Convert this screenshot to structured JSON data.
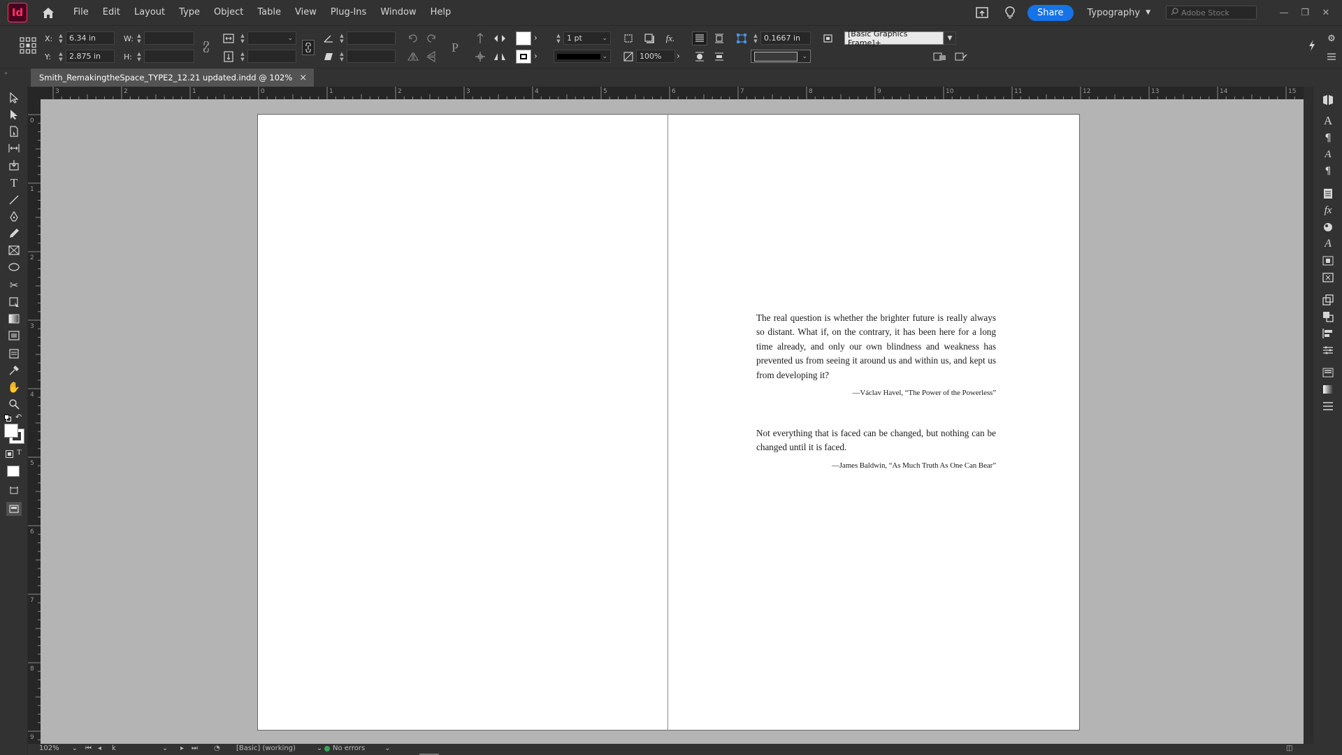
{
  "app": {
    "logo": "Id",
    "menu": [
      "File",
      "Edit",
      "Layout",
      "Type",
      "Object",
      "Table",
      "View",
      "Plug-Ins",
      "Window",
      "Help"
    ],
    "share_label": "Share",
    "workspace_label": "Typography",
    "stock_placeholder": "Adobe Stock",
    "accent_color": "#1473e6"
  },
  "control_panel": {
    "x_label": "X:",
    "x_value": "6.34 in",
    "y_label": "Y:",
    "y_value": "2.875 in",
    "w_label": "W:",
    "h_label": "H:",
    "stroke_weight": "1 pt",
    "opacity": "100%",
    "corner_size": "0.1667 in",
    "object_style": "[Basic Graphics Frame]+"
  },
  "document": {
    "tab_title": "Smith_RemakingtheSpace_TYPE2_12.21 updated.indd @ 102%",
    "close_glyph": "×"
  },
  "rulers": {
    "horizontal": [
      "3",
      "2",
      "1",
      "0",
      "1",
      "2",
      "3",
      "4",
      "5",
      "6",
      "7",
      "8",
      "9",
      "10",
      "11",
      "12",
      "13",
      "14",
      "15"
    ],
    "vertical": [
      "0",
      "1",
      "2",
      "3",
      "4",
      "5",
      "6",
      "7",
      "8",
      "9"
    ]
  },
  "content": {
    "quote1_text": "The real question is whether the brighter future is really always so distant. What if, on the contrary, it has been here for a long time already, and only our own blindness and weakness has prevented us from seeing it around us and within us, and kept us from developing it?",
    "quote1_attr": "—Václav Havel, “The Power of the Powerless”",
    "quote2_text": "Not everything that is faced can be changed, but nothing can be changed until it is faced.",
    "quote2_attr": "—James Baldwin, “As Much Truth As One Can Bear”"
  },
  "status": {
    "zoom": "102%",
    "page": "k",
    "preflight_profile": "[Basic] (working)",
    "errors": "No errors",
    "ok_color": "#3aa655"
  }
}
